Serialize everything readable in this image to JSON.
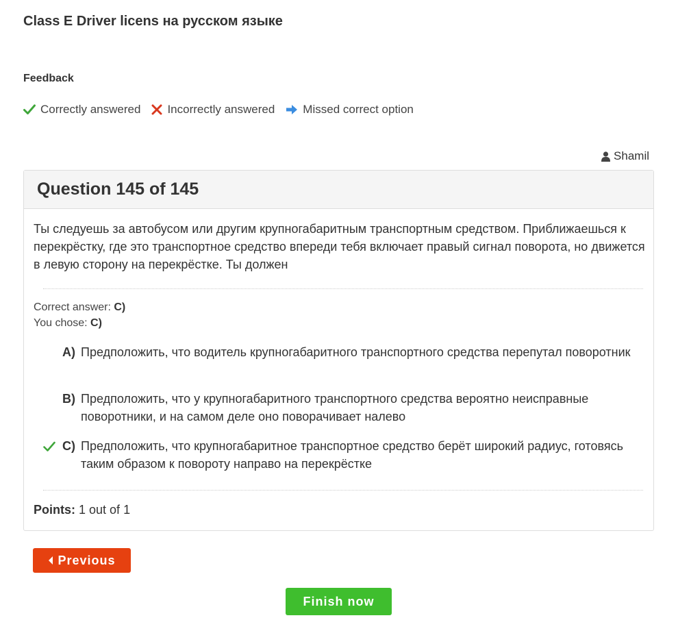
{
  "page": {
    "title": "Class E Driver licens на русском языке"
  },
  "feedback": {
    "heading": "Feedback",
    "legend": [
      {
        "icon": "check-icon",
        "label": "Correctly answered",
        "color": "#3fa63a"
      },
      {
        "icon": "cross-icon",
        "label": "Incorrectly answered",
        "color": "#d9381e"
      },
      {
        "icon": "arrow-right-icon",
        "label": "Missed correct option",
        "color": "#3b8de0"
      }
    ]
  },
  "user": {
    "icon": "user-icon",
    "name": "Shamil"
  },
  "question": {
    "header": "Question 145 of 145",
    "text": "Ты следуешь за автобусом или другим крупногабаритным транспортным средством. Приближаешься к перекрёстку, где это транспортное средство впереди тебя включает правый сигнал поворота, но движется в левую сторону на перекрёстке. Ты должен",
    "correct_answer_label": "Correct answer:",
    "correct_answer_value": "C)",
    "you_chose_label": "You chose:",
    "you_chose_value": "C)",
    "options": [
      {
        "letter": "A)",
        "text": "Предположить, что водитель крупногабаритного транспортного средства перепутал поворотник",
        "mark": ""
      },
      {
        "letter": "B)",
        "text": "Предположить, что у крупногабаритного транспортного средства вероятно неисправные поворотники, и на самом деле оно поворачивает налево",
        "mark": ""
      },
      {
        "letter": "C)",
        "text": "Предположить, что крупногабаритное транспортное средство берёт широкий радиус, готовясь таким образом к повороту направо на перекрёстке",
        "mark": "check-icon"
      }
    ],
    "points_label": "Points:",
    "points_value": "1 out of 1"
  },
  "navigation": {
    "previous_label": "Previous",
    "finish_label": "Finish now"
  },
  "colors": {
    "previous_button": "#e64110",
    "finish_button": "#3fbe2e",
    "check": "#3fa63a"
  }
}
